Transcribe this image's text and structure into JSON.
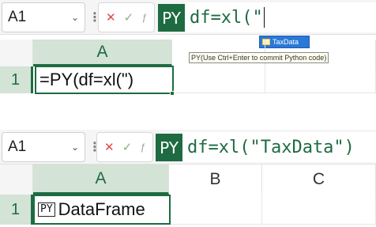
{
  "top": {
    "name_box": "A1",
    "py_badge": "PY",
    "formula_text": "df=xl(\"",
    "autocomplete_item": "TaxData",
    "tooltip": "PY(Use Ctrl+Enter to commit Python code)",
    "col_a": "A",
    "row_1": "1",
    "cell_a1": "=PY(df=xl(\")"
  },
  "bottom": {
    "name_box": "A1",
    "py_badge": "PY",
    "formula_text": "df=xl(\"TaxData\")",
    "col_a": "A",
    "col_b": "B",
    "col_c": "C",
    "row_1": "1",
    "cell_badge": "PY",
    "cell_a1": "DataFrame"
  },
  "icons": {
    "cancel": "✕",
    "enter": "✓",
    "insert_function": "ƒ"
  },
  "colors": {
    "excel_green": "#1e6b41",
    "header_selected": "#d3e3d5",
    "autocomplete_blue": "#2b78d6"
  }
}
